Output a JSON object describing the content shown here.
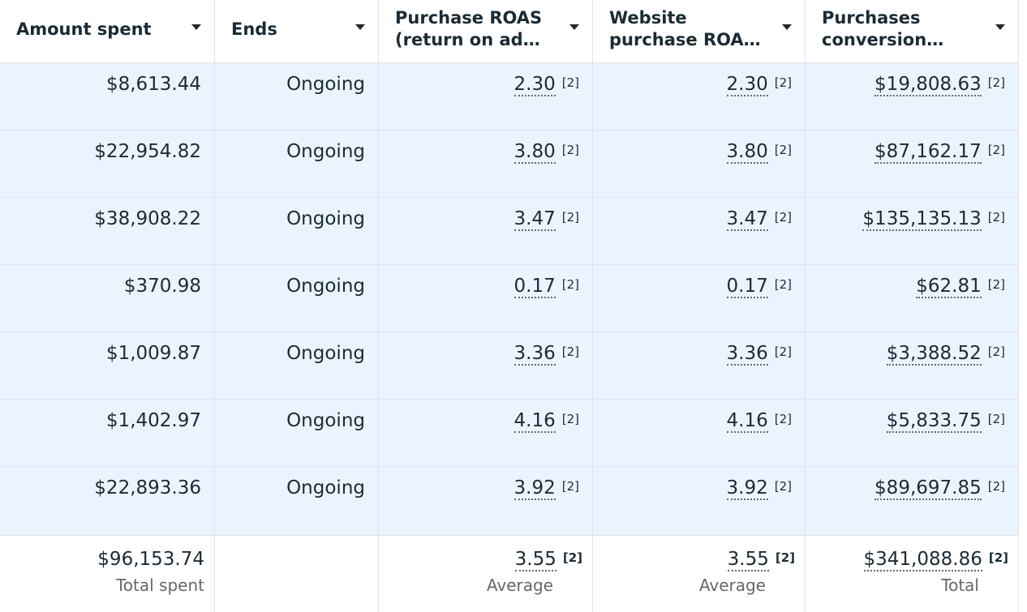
{
  "columns": [
    {
      "label": "Amount spent"
    },
    {
      "label": "Ends"
    },
    {
      "label_line1": "Purchase ROAS",
      "label_line2": "(return on ad…"
    },
    {
      "label_line1": "Website",
      "label_line2": "purchase ROA…"
    },
    {
      "label_line1": "Purchases",
      "label_line2": "conversion…"
    }
  ],
  "rows": [
    {
      "spent": "$8,613.44",
      "ends": "Ongoing",
      "roas": "2.30",
      "web_roas": "2.30",
      "conv": "$19,808.63",
      "ref": "[2]"
    },
    {
      "spent": "$22,954.82",
      "ends": "Ongoing",
      "roas": "3.80",
      "web_roas": "3.80",
      "conv": "$87,162.17",
      "ref": "[2]"
    },
    {
      "spent": "$38,908.22",
      "ends": "Ongoing",
      "roas": "3.47",
      "web_roas": "3.47",
      "conv": "$135,135.13",
      "ref": "[2]"
    },
    {
      "spent": "$370.98",
      "ends": "Ongoing",
      "roas": "0.17",
      "web_roas": "0.17",
      "conv": "$62.81",
      "ref": "[2]"
    },
    {
      "spent": "$1,009.87",
      "ends": "Ongoing",
      "roas": "3.36",
      "web_roas": "3.36",
      "conv": "$3,388.52",
      "ref": "[2]"
    },
    {
      "spent": "$1,402.97",
      "ends": "Ongoing",
      "roas": "4.16",
      "web_roas": "4.16",
      "conv": "$5,833.75",
      "ref": "[2]"
    },
    {
      "spent": "$22,893.36",
      "ends": "Ongoing",
      "roas": "3.92",
      "web_roas": "3.92",
      "conv": "$89,697.85",
      "ref": "[2]"
    }
  ],
  "totals": {
    "spent": "$96,153.74",
    "spent_label": "Total spent",
    "roas": "3.55",
    "roas_label": "Average",
    "web_roas": "3.55",
    "web_roas_label": "Average",
    "conv": "$341,088.86",
    "conv_label": "Total",
    "ref": "[2]"
  },
  "icons": {
    "sort": "caret-down-icon"
  },
  "colors": {
    "row_bg": "#ebf4fe",
    "header_bg": "#ffffff",
    "text": "#1c2b33",
    "muted": "#65676b"
  }
}
